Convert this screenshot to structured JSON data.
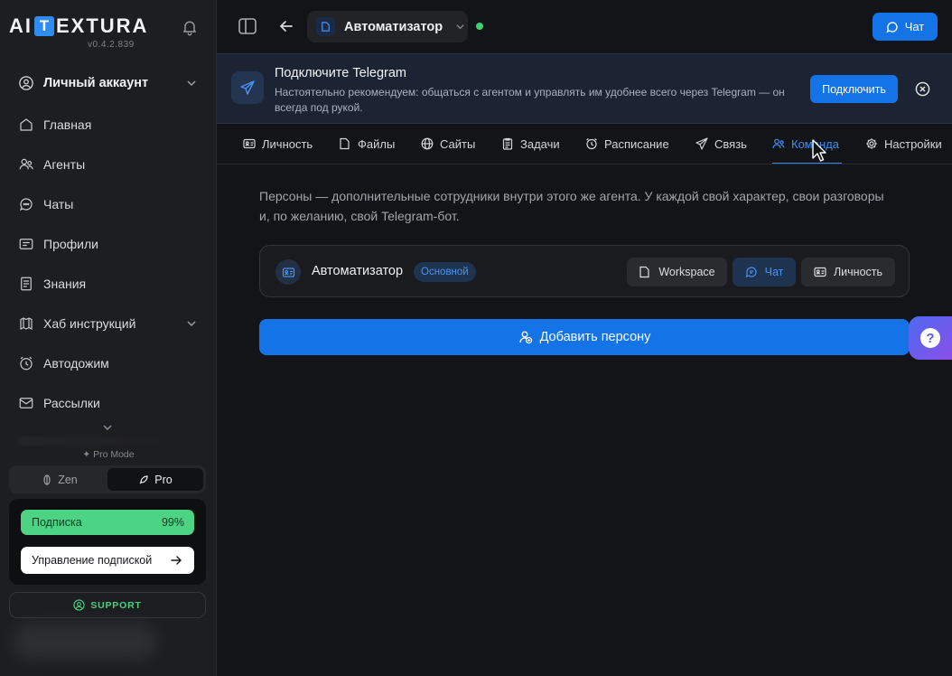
{
  "app": {
    "logo_left": "AI",
    "logo_box": "T",
    "logo_right": "EXTURA",
    "version": "v0.4.2.839"
  },
  "sidebar": {
    "account": "Личный аккаунт",
    "items": [
      {
        "label": "Главная",
        "icon": "home-icon"
      },
      {
        "label": "Агенты",
        "icon": "users-icon"
      },
      {
        "label": "Чаты",
        "icon": "chat-icon"
      },
      {
        "label": "Профили",
        "icon": "profile-card-icon"
      },
      {
        "label": "Знания",
        "icon": "book-icon"
      },
      {
        "label": "Хаб инструкций",
        "icon": "hub-icon"
      },
      {
        "label": "Автодожим",
        "icon": "clock-icon"
      },
      {
        "label": "Рассылки",
        "icon": "mail-icon"
      }
    ],
    "pro_mode_label": "Pro Mode",
    "mode_zen": "Zen",
    "mode_pro": "Pro",
    "subscription_label": "Подписка",
    "subscription_percent": "99%",
    "subscription_fraction": 0.99,
    "manage_subscription": "Управление подпиской",
    "support": "SUPPORT"
  },
  "topbar": {
    "agent_name": "Автоматизатор",
    "status": "online",
    "chat_button": "Чат"
  },
  "banner": {
    "title": "Подключите Telegram",
    "text": "Настоятельно рекомендуем: общаться с агентом и управлять им удобнее всего через Telegram — он всегда под рукой.",
    "connect_button": "Подключить"
  },
  "tabs": [
    {
      "label": "Личность",
      "icon": "id-card-icon"
    },
    {
      "label": "Файлы",
      "icon": "folder-icon"
    },
    {
      "label": "Сайты",
      "icon": "globe-icon"
    },
    {
      "label": "Задачи",
      "icon": "clipboard-icon"
    },
    {
      "label": "Расписание",
      "icon": "alarm-icon"
    },
    {
      "label": "Связь",
      "icon": "send-icon"
    },
    {
      "label": "Команда",
      "icon": "team-icon",
      "active": true
    },
    {
      "label": "Настройки",
      "icon": "gear-icon"
    }
  ],
  "team": {
    "description": "Персоны — дополнительные сотрудники внутри этого же агента. У каждой свой характер, свои разговоры и, по желанию, свой Telegram-бот.",
    "persona": {
      "name": "Автоматизатор",
      "badge": "Основной",
      "buttons": {
        "workspace": "Workspace",
        "chat": "Чат",
        "personality": "Личность"
      }
    },
    "add_persona": "Добавить персону"
  },
  "help": {
    "label": "?"
  },
  "colors": {
    "accent": "#1473e6",
    "tab_active": "#3b8ff3",
    "subscription": "#4cd484",
    "support": "#4ccf84",
    "online": "#3fd16f"
  }
}
